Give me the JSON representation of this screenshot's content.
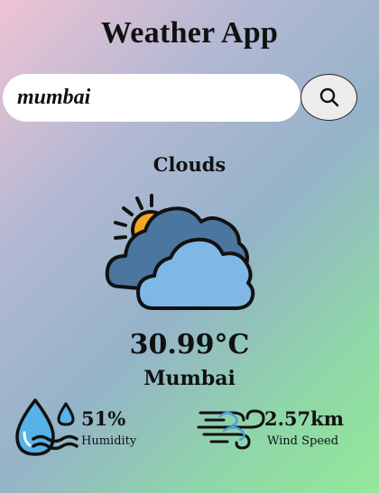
{
  "app": {
    "title": "Weather App"
  },
  "search": {
    "value": "mumbai",
    "placeholder": ""
  },
  "weather": {
    "condition": "Clouds",
    "icon": "cloud-sun-icon",
    "temperature": "30.99°C",
    "city": "Mumbai"
  },
  "details": {
    "humidity": {
      "value": "51%",
      "label": "Humidity",
      "icon": "humidity-drops-icon"
    },
    "wind": {
      "value": "2.57km",
      "label": "Wind Speed",
      "icon": "wind-icon"
    }
  },
  "colors": {
    "gradient": [
      "#eec3d3",
      "#95b3c9",
      "#94e89a"
    ],
    "cloud_dark": "#4a76a0",
    "cloud_light": "#7fb8e6",
    "sun": "#f5a623",
    "water": "#56b2e8"
  }
}
